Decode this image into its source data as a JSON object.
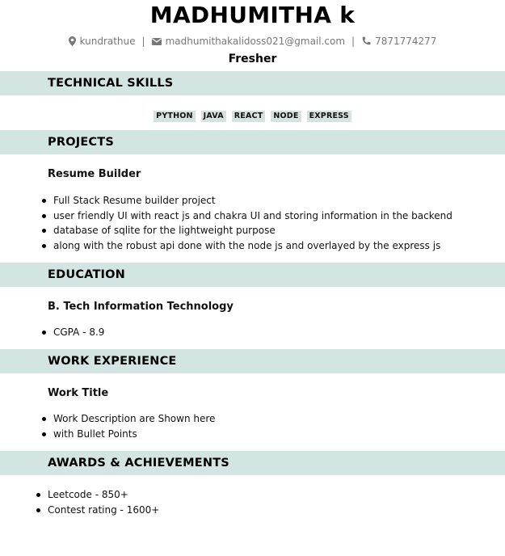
{
  "header": {
    "name": "MADHUMITHA k",
    "location": "kundrathue",
    "email": "madhumithakalidoss021@gmail.com",
    "phone": "7871774277",
    "separator": "|",
    "role": "Fresher",
    "icons": {
      "location": "map-pin-icon",
      "email": "envelope-icon",
      "phone": "phone-icon"
    }
  },
  "sections": {
    "skills": {
      "title": "TECHNICAL SKILLS",
      "items": [
        "PYTHON",
        "JAVA",
        "REACT",
        "NODE",
        "EXPRESS"
      ]
    },
    "projects": {
      "title": "PROJECTS",
      "project_title": "Resume Builder",
      "bullets": [
        "Full Stack Resume builder project",
        "user friendly UI with react js and chakra UI and storing information in the backend",
        "database of sqlite for the lightweight purpose",
        "along with the robust api done with the node js and overlayed by the express js"
      ]
    },
    "education": {
      "title": "EDUCATION",
      "degree": "B. Tech Information Technology",
      "bullets": [
        "CGPA - 8.9"
      ]
    },
    "experience": {
      "title": "WORK EXPERIENCE",
      "job_title": "Work Title",
      "bullets": [
        "Work Description are Shown here",
        "with Bullet Points"
      ]
    },
    "awards": {
      "title": "AWARDS & ACHIEVEMENTS",
      "bullets": [
        "Leetcode - 850+",
        "Contest rating - 1600+"
      ]
    }
  },
  "colors": {
    "section_band": "#d3e5e2",
    "skill_tag": "#d6e2e0",
    "contact_text": "#777777"
  }
}
